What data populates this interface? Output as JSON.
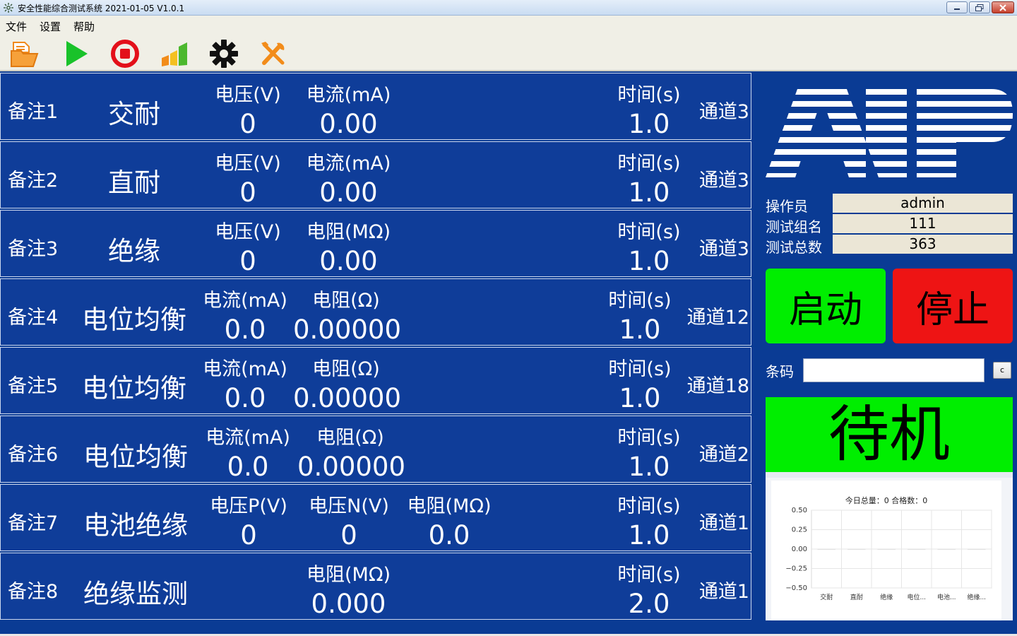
{
  "window": {
    "title": "安全性能综合测试系统 2021-01-05 V1.0.1"
  },
  "menu": [
    "文件",
    "设置",
    "帮助"
  ],
  "toolbar": {
    "icons": [
      "open-folder-icon",
      "play-icon",
      "stop-icon",
      "bar-chart-icon",
      "gear-icon",
      "tools-icon"
    ]
  },
  "rows": [
    {
      "note": "备注1",
      "type": "交耐",
      "headers": [
        "电压(V)",
        "电流(mA)"
      ],
      "values": [
        "0",
        "0.00"
      ],
      "time_header": "时间(s)",
      "time": "1.0",
      "channel": "通道3"
    },
    {
      "note": "备注2",
      "type": "直耐",
      "headers": [
        "电压(V)",
        "电流(mA)"
      ],
      "values": [
        "0",
        "0.00"
      ],
      "time_header": "时间(s)",
      "time": "1.0",
      "channel": "通道3"
    },
    {
      "note": "备注3",
      "type": "绝缘",
      "headers": [
        "电压(V)",
        "电阻(MΩ)"
      ],
      "values": [
        "0",
        "0.00"
      ],
      "time_header": "时间(s)",
      "time": "1.0",
      "channel": "通道3"
    },
    {
      "note": "备注4",
      "type": "电位均衡",
      "headers": [
        "电流(mA)",
        "电阻(Ω)"
      ],
      "values": [
        "0.0",
        "0.00000"
      ],
      "time_header": "时间(s)",
      "time": "1.0",
      "channel": "通道12"
    },
    {
      "note": "备注5",
      "type": "电位均衡",
      "headers": [
        "电流(mA)",
        "电阻(Ω)"
      ],
      "values": [
        "0.0",
        "0.00000"
      ],
      "time_header": "时间(s)",
      "time": "1.0",
      "channel": "通道18"
    },
    {
      "note": "备注6",
      "type": "电位均衡",
      "headers": [
        "电流(mA)",
        "电阻(Ω)"
      ],
      "values": [
        "0.0",
        "0.00000"
      ],
      "time_header": "时间(s)",
      "time": "1.0",
      "channel": "通道2"
    },
    {
      "note": "备注7",
      "type": "电池绝缘",
      "headers": [
        "电压P(V)",
        "电压N(V)",
        "电阻(MΩ)"
      ],
      "values": [
        "0",
        "0",
        "0.0"
      ],
      "time_header": "时间(s)",
      "time": "1.0",
      "channel": "通道1"
    },
    {
      "note": "备注8",
      "type": "绝缘监测",
      "headers": [
        "电阻(MΩ)"
      ],
      "values": [
        "0.000"
      ],
      "time_header": "时间(s)",
      "time": "2.0",
      "channel": "通道1"
    }
  ],
  "panel": {
    "operator_label": "操作员",
    "operator": "admin",
    "group_label": "测试组名",
    "group": "111",
    "total_label": "测试总数",
    "total": "363",
    "start_label": "启动",
    "stop_label": "停止",
    "barcode_label": "条码",
    "barcode_value": "",
    "barcode_clear": "c",
    "status": "待机",
    "colors": {
      "start": "#00ee00",
      "stop": "#ee1414",
      "status": "#00ee00",
      "row_bg": "#0f3d99"
    }
  },
  "chart_data": {
    "type": "bar",
    "title": "今日总量：0 合格数：0",
    "categories": [
      "交耐",
      "直耐",
      "绝缘",
      "电位...",
      "电池...",
      "绝缘..."
    ],
    "values": [
      0,
      0,
      0,
      0,
      0,
      0
    ],
    "yticks": [
      "0.50",
      "0.25",
      "0.00",
      "−0.25",
      "−0.50"
    ],
    "ylim": [
      -0.5,
      0.5
    ],
    "grid": true
  }
}
